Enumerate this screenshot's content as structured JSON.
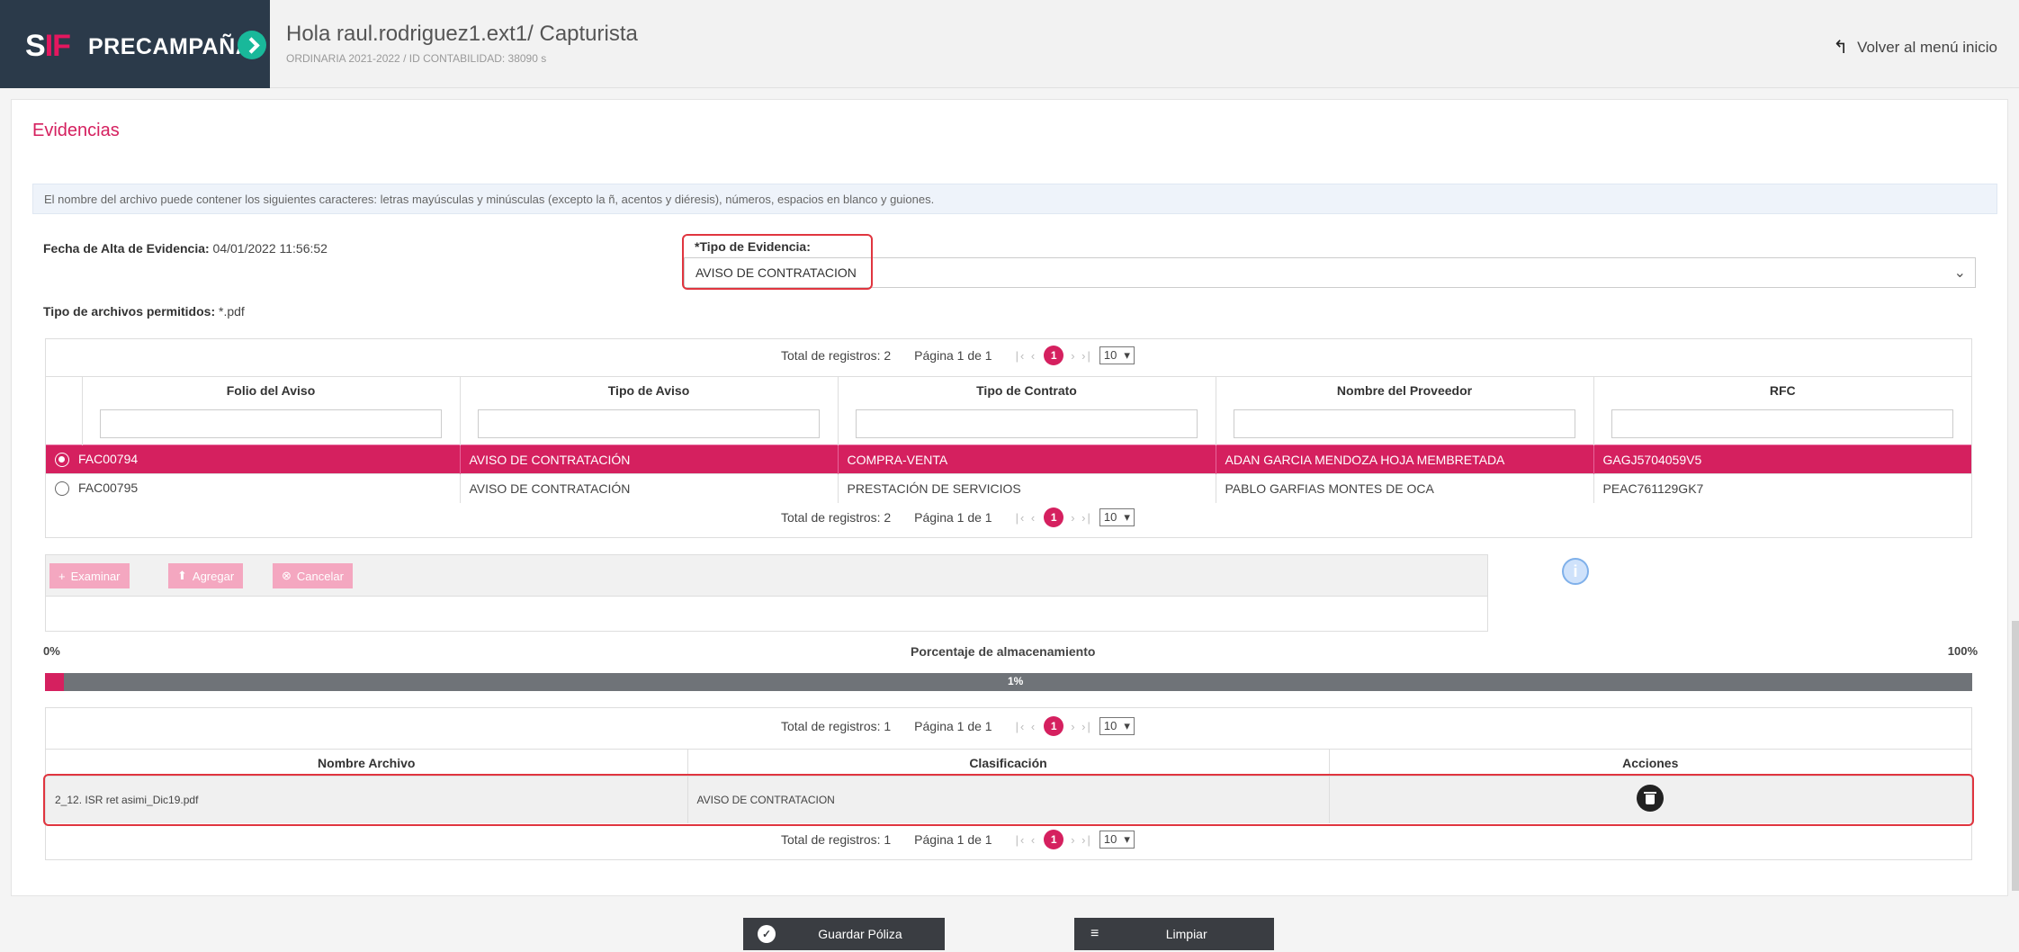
{
  "header": {
    "brand_logo": "SIF",
    "brand_name": "PRECAMPAÑA",
    "greeting": "Hola raul.rodriguez1.ext1/ Capturista",
    "subtitle": "ORDINARIA 2021-2022 / ID CONTABILIDAD: 38090 s",
    "back_label": "Volver al menú inicio"
  },
  "page": {
    "title": "Evidencias",
    "info": "El nombre del archivo puede contener los siguientes caracteres: letras mayúsculas y minúsculas (excepto la ñ, acentos y diéresis), números, espacios en blanco y guiones.",
    "fecha_label": "Fecha de Alta de Evidencia:",
    "fecha_value": "04/01/2022 11:56:52",
    "tipo_label": "*Tipo de Evidencia:",
    "tipo_value": "AVISO DE CONTRATACION",
    "permit_label": "Tipo de archivos permitidos:",
    "permit_value": "*.pdf"
  },
  "pager1": {
    "total_label": "Total de registros: 2",
    "page_label": "Página 1 de 1",
    "current": "1",
    "size": "10"
  },
  "avisos": {
    "headers": [
      "Folio del Aviso",
      "Tipo de Aviso",
      "Tipo de Contrato",
      "Nombre del Proveedor",
      "RFC"
    ],
    "rows": [
      [
        "FAC00794",
        "AVISO DE CONTRATACIÓN",
        "COMPRA-VENTA",
        "ADAN GARCIA MENDOZA HOJA MEMBRETADA",
        "GAGJ5704059V5"
      ],
      [
        "FAC00795",
        "AVISO DE CONTRATACIÓN",
        "PRESTACIÓN DE SERVICIOS",
        "PABLO GARFIAS MONTES DE OCA",
        "PEAC761129GK7"
      ]
    ]
  },
  "upload": {
    "examinar": "Examinar",
    "agregar": "Agregar",
    "cancelar": "Cancelar"
  },
  "storage": {
    "min_label": "0%",
    "max_label": "100%",
    "label": "Porcentaje de almacenamiento",
    "percent_text": "1%",
    "percent": 1
  },
  "pager2": {
    "total_label": "Total de registros: 1",
    "page_label": "Página 1 de 1",
    "current": "1",
    "size": "10"
  },
  "archivos": {
    "headers": [
      "Nombre Archivo",
      "Clasificación",
      "Acciones"
    ],
    "rows": [
      [
        "2_12. ISR ret asimi_Dic19.pdf",
        "AVISO DE CONTRATACION"
      ]
    ]
  },
  "buttons": {
    "guardar": "Guardar Póliza",
    "limpiar": "Limpiar"
  },
  "colors": {
    "accent": "#d5205f",
    "dark": "#2b3a4a",
    "highlight": "#e0353f"
  }
}
